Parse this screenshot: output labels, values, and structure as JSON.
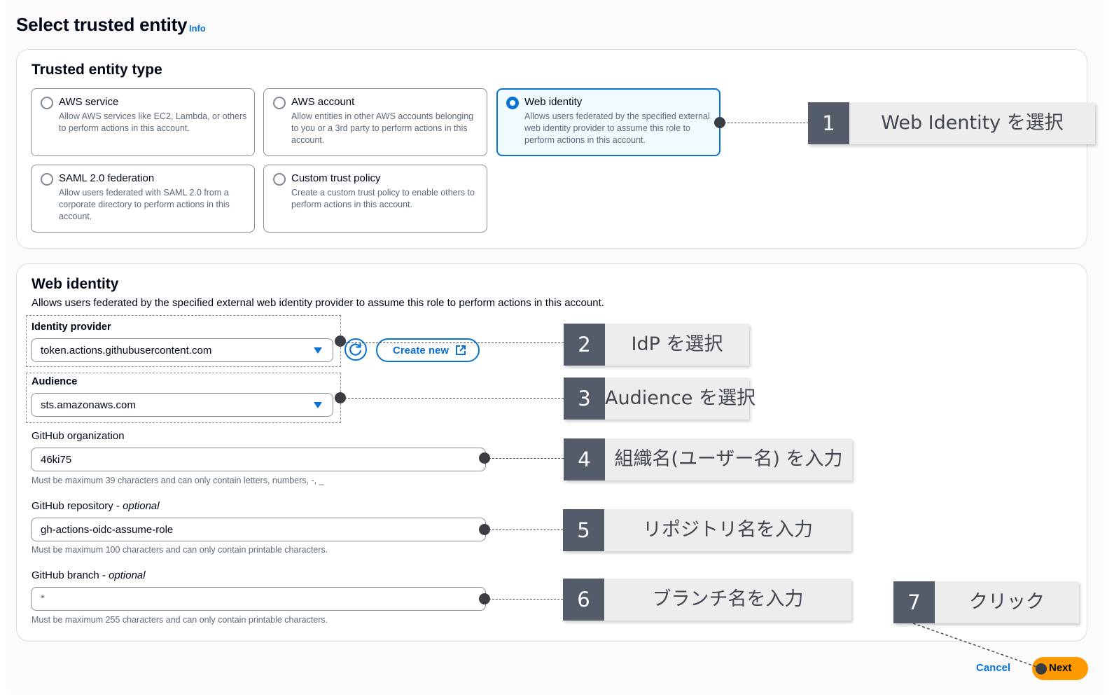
{
  "page": {
    "title": "Select trusted entity",
    "info_link": "Info"
  },
  "entity_type": {
    "heading": "Trusted entity type",
    "tiles": [
      {
        "title": "AWS service",
        "desc": "Allow AWS services like EC2, Lambda, or others to perform actions in this account.",
        "selected": false
      },
      {
        "title": "AWS account",
        "desc": "Allow entities in other AWS accounts belonging to you or a 3rd party to perform actions in this account.",
        "selected": false
      },
      {
        "title": "Web identity",
        "desc": "Allows users federated by the specified external web identity provider to assume this role to perform actions in this account.",
        "selected": true
      },
      {
        "title": "SAML 2.0 federation",
        "desc": "Allow users federated with SAML 2.0 from a corporate directory to perform actions in this account.",
        "selected": false
      },
      {
        "title": "Custom trust policy",
        "desc": "Create a custom trust policy to enable others to perform actions in this account.",
        "selected": false
      }
    ]
  },
  "web_identity": {
    "heading": "Web identity",
    "description": "Allows users federated by the specified external web identity provider to assume this role to perform actions in this account.",
    "identity_provider": {
      "label": "Identity provider",
      "value": "token.actions.githubusercontent.com",
      "create_new_label": "Create new"
    },
    "audience": {
      "label": "Audience",
      "value": "sts.amazonaws.com"
    },
    "github_org": {
      "label": "GitHub organization",
      "value": "46ki75",
      "hint": "Must be maximum 39 characters and can only contain letters, numbers, -, _"
    },
    "github_repo": {
      "label": "GitHub repository",
      "optional": "optional",
      "value": "gh-actions-oidc-assume-role",
      "hint": "Must be maximum 100 characters and can only contain printable characters."
    },
    "github_branch": {
      "label": "GitHub branch",
      "optional": "optional",
      "placeholder": "*",
      "hint": "Must be maximum 255 characters and can only contain printable characters."
    }
  },
  "footer": {
    "cancel_label": "Cancel",
    "next_label": "Next"
  },
  "annotations": [
    {
      "number": "1",
      "text": "Web Identity を選択"
    },
    {
      "number": "2",
      "text": "IdP を選択"
    },
    {
      "number": "3",
      "text": "Audience を選択"
    },
    {
      "number": "4",
      "text": "組織名(ユーザー名) を入力"
    },
    {
      "number": "5",
      "text": "リポジトリ名を入力"
    },
    {
      "number": "6",
      "text": "ブランチ名を入力"
    },
    {
      "number": "7",
      "text": "クリック"
    }
  ],
  "colors": {
    "accent": "#0972d3",
    "primary_button": "#ff9900",
    "callout_number_bg": "#545b69",
    "callout_bg": "#ededee"
  },
  "icons": {
    "refresh": "refresh-icon",
    "external": "external-link-icon",
    "dropdown": "caret-down-icon"
  }
}
